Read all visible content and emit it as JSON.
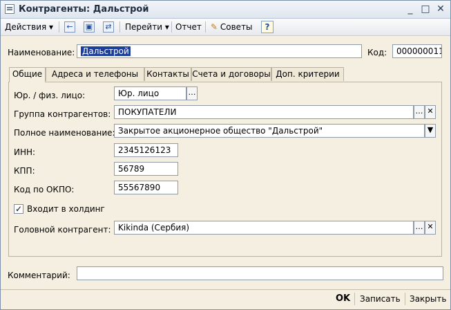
{
  "window": {
    "title": "Контрагенты: Дальстрой"
  },
  "toolbar": {
    "actions": "Действия",
    "goto": "Перейти",
    "report": "Отчет",
    "tips": "Советы",
    "help": "?"
  },
  "header": {
    "name_label": "Наименование:",
    "name_value": "Дальстрой",
    "code_label": "Код:",
    "code_value": "000000011"
  },
  "tabs": [
    "Общие",
    "Адреса и телефоны",
    "Контакты",
    "Счета и договоры",
    "Доп. критерии"
  ],
  "general": {
    "entity_label": "Юр. / физ. лицо:",
    "entity_value": "Юр. лицо",
    "group_label": "Группа контрагентов:",
    "group_value": "ПОКУПАТЕЛИ",
    "full_name_label": "Полное наименование:",
    "full_name_value": "Закрытое акционерное общество \"Дальстрой\"",
    "inn_label": "ИНН:",
    "inn_value": "2345126123",
    "kpp_label": "КПП:",
    "kpp_value": "56789",
    "okpo_label": "Код по ОКПО:",
    "okpo_value": "55567890",
    "holding_label": "Входит в холдинг",
    "holding_checked": true,
    "parent_label": "Головной контрагент:",
    "parent_value": "Kikinda (Сербия)"
  },
  "comment": {
    "label": "Комментарий:",
    "value": ""
  },
  "footer": {
    "ok": "OK",
    "save": "Записать",
    "close": "Закрыть"
  }
}
